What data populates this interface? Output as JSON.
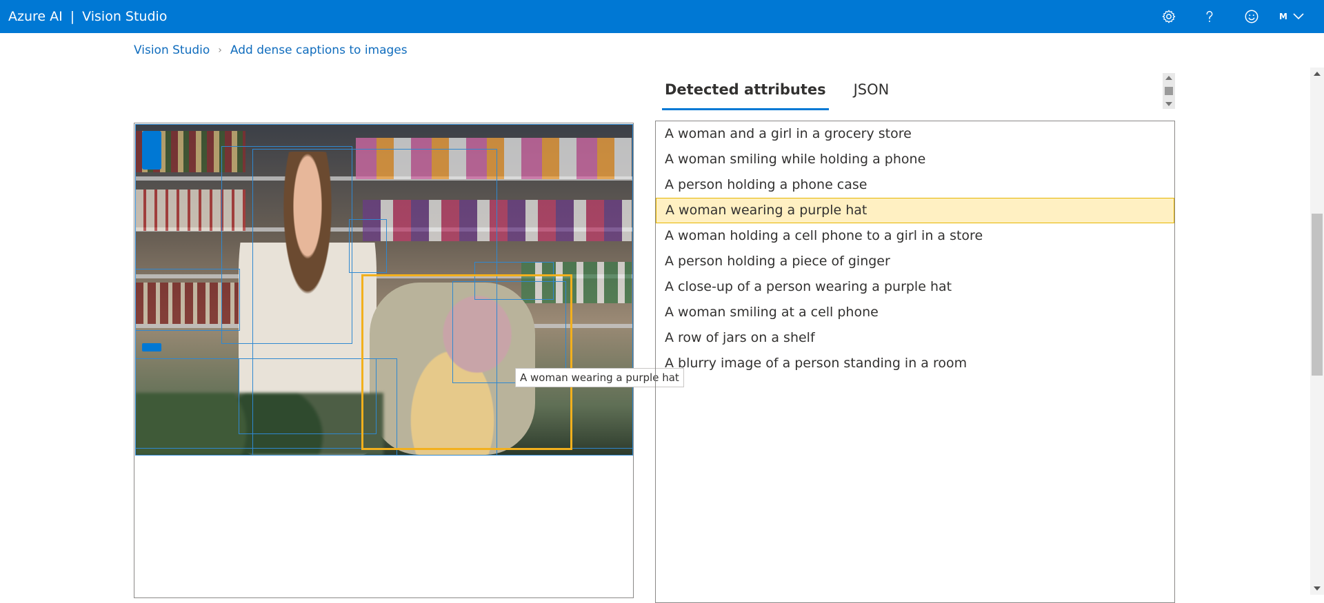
{
  "header": {
    "brand": "Azure AI",
    "separator": "|",
    "product": "Vision Studio",
    "user_initial": "M",
    "icons": [
      "gear-icon",
      "help-icon",
      "feedback-smiley-icon",
      "chevron-down-icon"
    ]
  },
  "breadcrumb": {
    "items": [
      "Vision Studio",
      "Add dense captions to images"
    ]
  },
  "image_panel": {
    "tooltip": "A woman wearing a purple hat"
  },
  "tabs": {
    "items": [
      "Detected attributes",
      "JSON"
    ],
    "active": "Detected attributes"
  },
  "captions": [
    "A woman and a girl in a grocery store",
    "A woman smiling while holding a phone",
    "A person holding a phone case",
    "A woman wearing a purple hat",
    "A woman holding a cell phone to a girl in a store",
    "A person holding a piece of ginger",
    "A close-up of a person wearing a purple hat",
    "A woman smiling at a cell phone",
    "A row of jars on a shelf",
    "A blurry image of a person standing in a room"
  ],
  "selected_caption_index": 3,
  "colors": {
    "topbar": "#0078d4",
    "link": "#0f6cbd",
    "bbox": "#2f88d0",
    "bbox_selected": "#f2b01d",
    "row_selected": "#fff0c2"
  }
}
